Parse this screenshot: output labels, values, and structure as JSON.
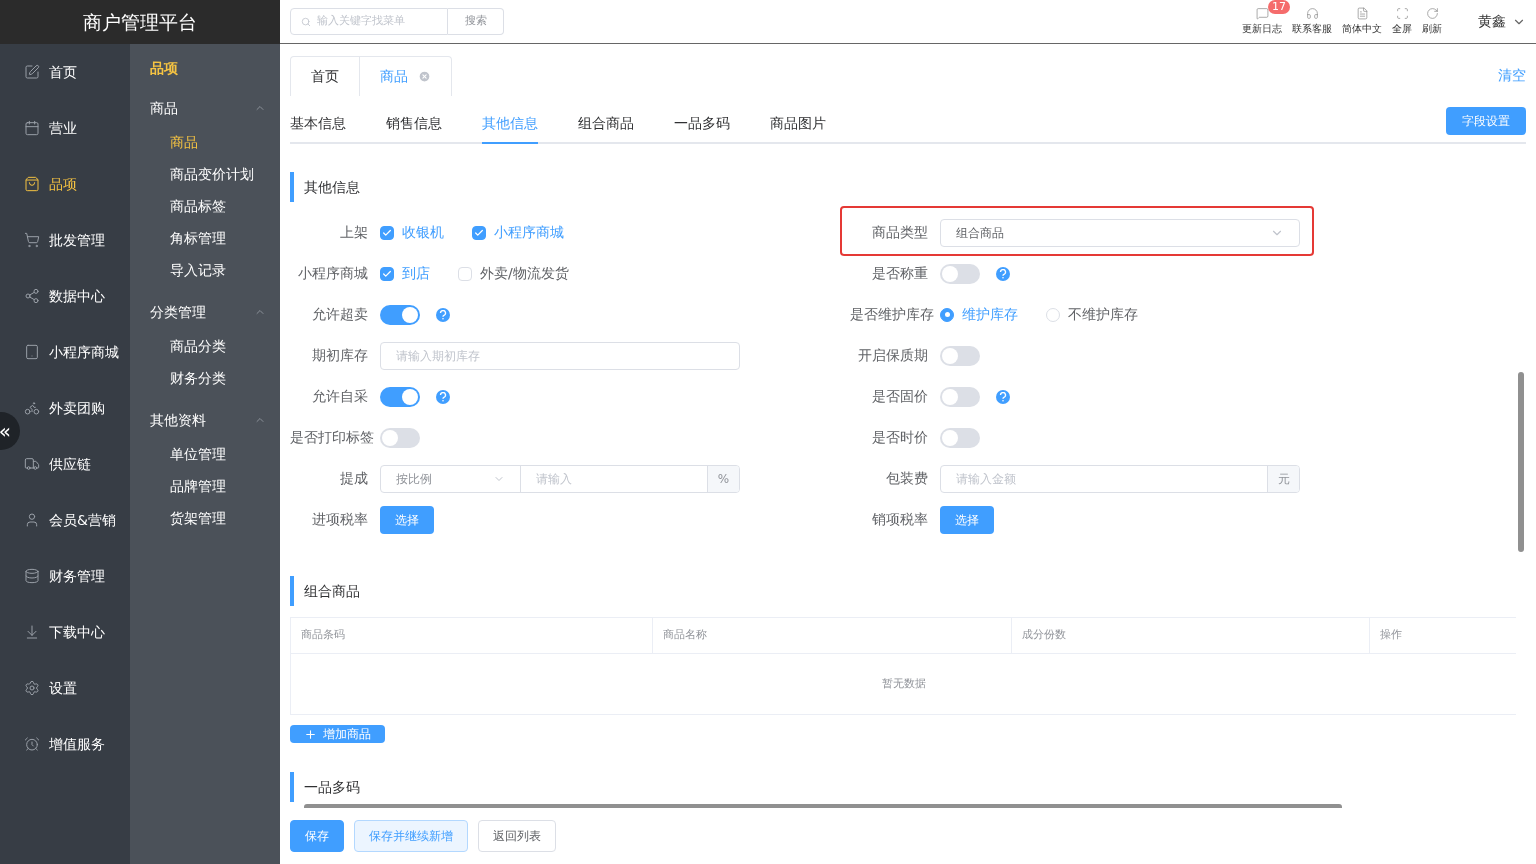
{
  "brand": "商户管理平台",
  "nav": [
    {
      "label": "首页",
      "selected": false
    },
    {
      "label": "营业",
      "selected": false
    },
    {
      "label": "品项",
      "selected": true
    },
    {
      "label": "批发管理",
      "selected": false
    },
    {
      "label": "数据中心",
      "selected": false
    },
    {
      "label": "小程序商城",
      "selected": false
    },
    {
      "label": "外卖团购",
      "selected": false
    },
    {
      "label": "供应链",
      "selected": false
    },
    {
      "label": "会员&营销",
      "selected": false
    },
    {
      "label": "财务管理",
      "selected": false
    },
    {
      "label": "下载中心",
      "selected": false
    },
    {
      "label": "设置",
      "selected": false
    },
    {
      "label": "增值服务",
      "selected": false
    }
  ],
  "collapse": "«",
  "subnav": {
    "title": "品项",
    "groups": [
      {
        "label": "商品",
        "expanded": true,
        "items": [
          {
            "label": "商品",
            "selected": true
          },
          {
            "label": "商品变价计划",
            "selected": false
          },
          {
            "label": "商品标签",
            "selected": false
          },
          {
            "label": "角标管理",
            "selected": false
          },
          {
            "label": "导入记录",
            "selected": false
          }
        ]
      },
      {
        "label": "分类管理",
        "expanded": true,
        "items": [
          {
            "label": "商品分类",
            "selected": false
          },
          {
            "label": "财务分类",
            "selected": false
          }
        ]
      },
      {
        "label": "其他资料",
        "expanded": true,
        "items": [
          {
            "label": "单位管理",
            "selected": false
          },
          {
            "label": "品牌管理",
            "selected": false
          },
          {
            "label": "货架管理",
            "selected": false
          }
        ]
      }
    ]
  },
  "search": {
    "placeholder": "输入关键字找菜单",
    "button": "搜索"
  },
  "toolbar": [
    {
      "label": "更新日志",
      "badge": "17"
    },
    {
      "label": "联系客服"
    },
    {
      "label": "简体中文"
    },
    {
      "label": "全屏"
    },
    {
      "label": "刷新"
    }
  ],
  "user": "黄鑫",
  "page_tabs": [
    {
      "label": "首页",
      "selected": false,
      "closable": false
    },
    {
      "label": "商品",
      "selected": true,
      "closable": true
    }
  ],
  "clear": "清空",
  "section_tabs": [
    {
      "label": "基本信息",
      "selected": false
    },
    {
      "label": "销售信息",
      "selected": false
    },
    {
      "label": "其他信息",
      "selected": true
    },
    {
      "label": "组合商品",
      "selected": false
    },
    {
      "label": "一品多码",
      "selected": false
    },
    {
      "label": "商品图片",
      "selected": false
    }
  ],
  "field_settings": "字段设置",
  "other_info": {
    "title": "其他信息",
    "left": [
      {
        "label": "上架",
        "kind": "checkboxes",
        "options": [
          {
            "label": "收银机",
            "checked": true
          },
          {
            "label": "小程序商城",
            "checked": true
          }
        ]
      },
      {
        "label": "小程序商城",
        "kind": "checkboxes",
        "options": [
          {
            "label": "到店",
            "checked": true
          },
          {
            "label": "外卖/物流发货",
            "checked": false
          }
        ]
      },
      {
        "label": "允许超卖",
        "kind": "switch",
        "on": true,
        "help": true
      },
      {
        "label": "期初库存",
        "kind": "input",
        "placeholder": "请输入期初库存"
      },
      {
        "label": "允许自采",
        "kind": "switch",
        "on": true,
        "help": true
      },
      {
        "label": "是否打印标签",
        "kind": "switch",
        "on": false,
        "help": false
      },
      {
        "label": "提成",
        "kind": "select_input",
        "select": "按比例",
        "placeholder": "请输入",
        "suffix": "%"
      },
      {
        "label": "进项税率",
        "kind": "button",
        "button": "选择"
      }
    ],
    "right": [
      {
        "label": "商品类型",
        "kind": "select",
        "value": "组合商品",
        "highlighted": true
      },
      {
        "label": "是否称重",
        "kind": "switch",
        "on": false,
        "help": true
      },
      {
        "label": "是否维护库存",
        "kind": "radios",
        "options": [
          {
            "label": "维护库存",
            "selected": true
          },
          {
            "label": "不维护库存",
            "selected": false
          }
        ]
      },
      {
        "label": "开启保质期",
        "kind": "switch",
        "on": false,
        "help": false
      },
      {
        "label": "是否固价",
        "kind": "switch",
        "on": false,
        "help": true
      },
      {
        "label": "是否时价",
        "kind": "switch",
        "on": false,
        "help": false
      },
      {
        "label": "包装费",
        "kind": "input",
        "placeholder": "请输入金额",
        "suffix": "元"
      },
      {
        "label": "销项税率",
        "kind": "button",
        "button": "选择"
      }
    ]
  },
  "combo": {
    "title": "组合商品",
    "columns": [
      "商品条码",
      "商品名称",
      "成分份数",
      "操作"
    ],
    "empty": "暂无数据",
    "add_button": "增加商品"
  },
  "multi_code": {
    "title": "一品多码"
  },
  "footer": [
    {
      "label": "保存",
      "kind": "primary"
    },
    {
      "label": "保存并继续新增",
      "kind": "secondary"
    },
    {
      "label": "返回列表",
      "kind": "default"
    }
  ]
}
